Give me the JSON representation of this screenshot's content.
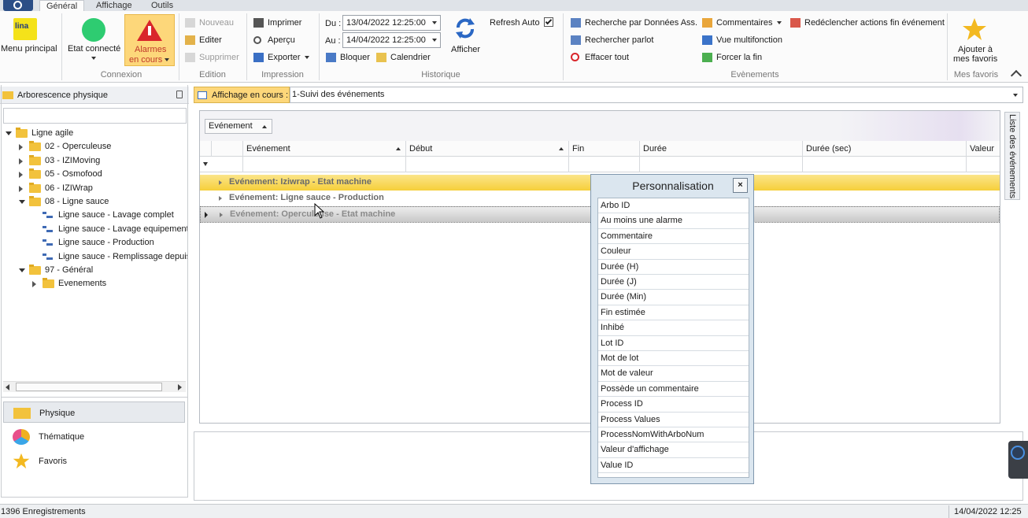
{
  "tabs": {
    "home": "",
    "general": "Général",
    "affichage": "Affichage",
    "outils": "Outils"
  },
  "ribbon": {
    "menu_principal": "Menu principal",
    "lina_logo": "lina",
    "etat_connecte": "Etat connecté",
    "alarmes_line1": "Alarmes",
    "alarmes_line2": "en cours",
    "connexion": "Connexion",
    "nouveau": "Nouveau",
    "editer": "Editer",
    "supprimer": "Supprimer",
    "edition": "Edition",
    "imprimer": "Imprimer",
    "apercu": "Aperçu",
    "exporter": "Exporter",
    "impression": "Impression",
    "du_label": "Du :",
    "du_value": "13/04/2022 12:25:00",
    "au_label": "Au :",
    "au_value": "14/04/2022 12:25:00",
    "bloquer": "Bloquer",
    "calendrier": "Calendrier",
    "afficher": "Afficher",
    "refresh_auto": "Refresh Auto",
    "historique": "Historique",
    "recherche_donnees": "Recherche par Données Ass.",
    "rechercher_parlot": "Rechercher parlot",
    "effacer_tout": "Effacer tout",
    "commentaires": "Commentaires",
    "vue_multifonction": "Vue multifonction",
    "forcer_fin": "Forcer la fin",
    "redeclencher": "Redéclencher actions fin événement",
    "evenements": "Evènements",
    "ajouter_line1": "Ajouter à",
    "ajouter_line2": "mes favoris",
    "mes_favoris": "Mes favoris"
  },
  "left": {
    "header": "Arborescence physique",
    "tree": [
      {
        "label": "Ligne agile"
      },
      {
        "label": "02 - Operculeuse"
      },
      {
        "label": "03 - IZIMoving"
      },
      {
        "label": "05 - Osmofood"
      },
      {
        "label": "06 - IZIWrap"
      },
      {
        "label": "08 - Ligne sauce"
      },
      {
        "label": "Ligne sauce - Lavage complet"
      },
      {
        "label": "Ligne sauce - Lavage equipement"
      },
      {
        "label": "Ligne sauce - Production"
      },
      {
        "label": "Ligne sauce - Remplissage depuis"
      },
      {
        "label": "97 - Général"
      },
      {
        "label": "Evenements"
      }
    ],
    "nav": {
      "physique": "Physique",
      "thematique": "Thématique",
      "favoris": "Favoris"
    }
  },
  "main": {
    "affichage_label": "Affichage en cours :",
    "affichage_value": "1-Suivi des événements",
    "group_chip": "Evénement",
    "side_tab": "Liste des événements",
    "columns": {
      "evenement": "Evénement",
      "debut": "Début",
      "fin": "Fin",
      "duree": "Durée",
      "duree_sec": "Durée (sec)",
      "valeur": "Valeur"
    },
    "filter_icon": "funnel-icon",
    "groups": [
      "Evénement: Iziwrap - Etat machine",
      "Evénement: Ligne sauce - Production",
      "Evénement: Operculeuse - Etat machine"
    ]
  },
  "popup": {
    "title": "Personnalisation",
    "close": "×",
    "items": [
      "Arbo ID",
      "Au moins une alarme",
      "Commentaire",
      "Couleur",
      "Durée (H)",
      "Durée (J)",
      "Durée (Min)",
      "Fin estimée",
      "Inhibé",
      "Lot ID",
      "Mot de lot",
      "Mot de valeur",
      "Possède un commentaire",
      "Process ID",
      "Process Values",
      "ProcessNomWithArboNum",
      "Valeur d'affichage",
      "Value ID"
    ]
  },
  "status": {
    "records": "1396 Enregistrements",
    "datetime": "14/04/2022 12:25"
  },
  "colors": {
    "ribbon_active": "#fdd77a",
    "group_highlight": "#f6cf3a",
    "connected": "#2ecc71",
    "alarm": "#d9262b",
    "star": "#f3b921",
    "tab_blue": "#2b4e86"
  }
}
